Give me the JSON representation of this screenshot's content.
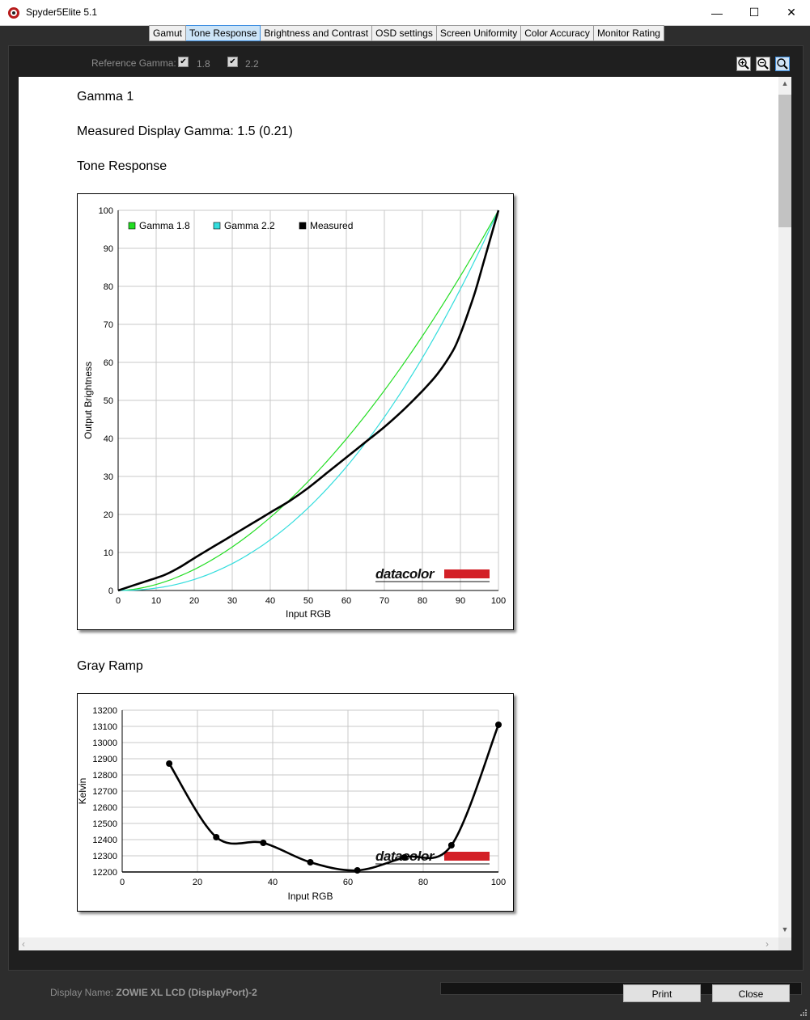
{
  "window": {
    "title": "Spyder5Elite 5.1",
    "minimize_glyph": "—",
    "maximize_glyph": "☐",
    "close_glyph": "✕"
  },
  "tabs": [
    {
      "label": "Gamut",
      "active": false
    },
    {
      "label": "Tone Response",
      "active": true
    },
    {
      "label": "Brightness and Contrast",
      "active": false
    },
    {
      "label": "OSD settings",
      "active": false
    },
    {
      "label": "Screen Uniformity",
      "active": false
    },
    {
      "label": "Color Accuracy",
      "active": false
    },
    {
      "label": "Monitor Rating",
      "active": false
    }
  ],
  "toolbar": {
    "reference_gamma_label": "Reference Gamma:",
    "gamma18_label": "1.8",
    "gamma18_checked": true,
    "gamma22_label": "2.2",
    "gamma22_checked": true,
    "zoom_in": "zoom-in-icon",
    "zoom_out": "zoom-out-icon",
    "zoom_fit": "zoom-fit-icon"
  },
  "report": {
    "heading": "Gamma 1",
    "measured_gamma": "Measured Display Gamma: 1.5 (0.21)",
    "tone_response_title": "Tone Response",
    "gray_ramp_title": "Gray Ramp"
  },
  "chart_data": [
    {
      "type": "line",
      "xlabel": "Input RGB",
      "ylabel": "Output Brightness",
      "xlim": [
        0,
        100
      ],
      "ylim": [
        0,
        100
      ],
      "xticks": [
        0,
        10,
        20,
        30,
        40,
        50,
        60,
        70,
        80,
        90,
        100
      ],
      "yticks": [
        0,
        10,
        20,
        30,
        40,
        50,
        60,
        70,
        80,
        90,
        100
      ],
      "grid": true,
      "legend": "top-left",
      "logo": "datacolor",
      "series": [
        {
          "name": "Gamma 1.8",
          "color": "#22dd22",
          "gamma": 1.8
        },
        {
          "name": "Gamma 2.2",
          "color": "#33dddd",
          "gamma": 2.2
        },
        {
          "name": "Measured",
          "color": "#000000",
          "x": [
            0,
            6,
            12,
            16,
            20,
            25,
            30,
            35,
            40,
            45,
            50,
            55,
            60,
            65,
            70,
            75,
            80,
            84,
            88,
            90,
            92,
            94,
            96,
            98,
            100
          ],
          "y": [
            0,
            2,
            4,
            6,
            8.5,
            11.5,
            14.5,
            17.5,
            20.5,
            23.5,
            27,
            31,
            35,
            39,
            43,
            47.5,
            52.5,
            57,
            63,
            67.5,
            73,
            79,
            86,
            93,
            100
          ]
        }
      ]
    },
    {
      "type": "line",
      "xlabel": "Input RGB",
      "ylabel": "Kelvin",
      "xlim": [
        0,
        100
      ],
      "ylim": [
        12200,
        13200
      ],
      "xticks": [
        0,
        20,
        40,
        60,
        80,
        100
      ],
      "yticks": [
        12200,
        12300,
        12400,
        12500,
        12600,
        12700,
        12800,
        12900,
        13000,
        13100,
        13200
      ],
      "grid": true,
      "logo": "datacolor",
      "series": [
        {
          "name": "",
          "color": "#000000",
          "x": [
            12.5,
            25,
            37.5,
            50,
            62.5,
            75,
            87.5,
            100
          ],
          "y": [
            12870,
            12415,
            12380,
            12260,
            12210,
            12290,
            12365,
            13110
          ]
        }
      ]
    }
  ],
  "footer": {
    "display_name_label": "Display Name:",
    "display_name_value": "ZOWIE XL LCD (DisplayPort)-2",
    "print_label": "Print",
    "close_label": "Close"
  }
}
